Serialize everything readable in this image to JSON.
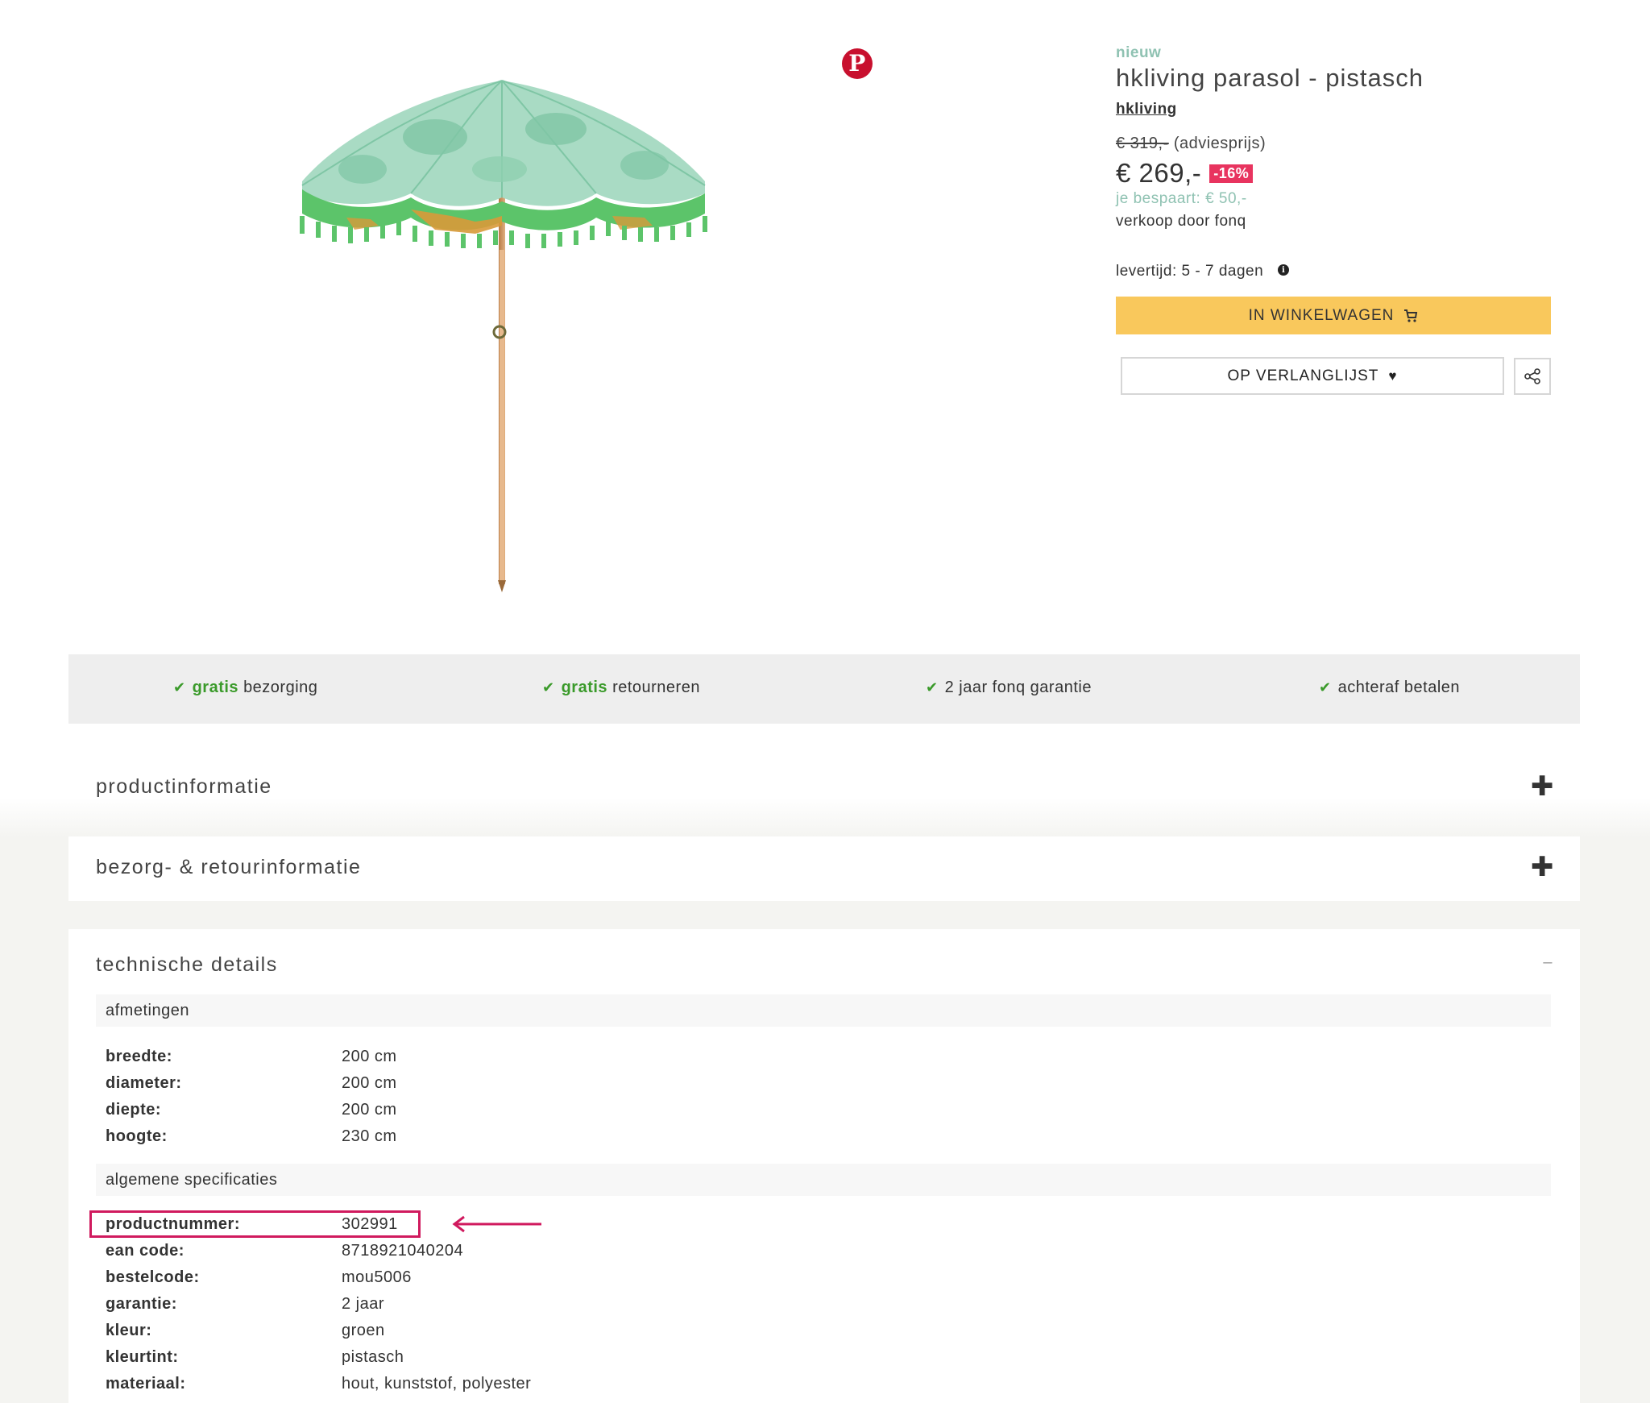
{
  "product": {
    "badge": "nieuw",
    "title": "hkliving parasol - pistasch",
    "brand": "hkliving",
    "old_price": "€ 319,-",
    "old_price_note": "(adviesprijs)",
    "price": "€ 269,-",
    "discount": "-16%",
    "savings": "je bespaart: € 50,-",
    "seller": "verkoop door fonq",
    "delivery": "levertijd: 5 - 7 dagen",
    "cart_label": "IN WINKELWAGEN",
    "wishlist_label": "OP VERLANGLIJST"
  },
  "usps": [
    {
      "highlight": "gratis",
      "text": "bezorging"
    },
    {
      "highlight": "gratis",
      "text": "retourneren"
    },
    {
      "highlight": "",
      "text": "2 jaar fonq garantie"
    },
    {
      "highlight": "",
      "text": "achteraf betalen"
    }
  ],
  "accordions": {
    "productinfo": "productinformatie",
    "shipping": "bezorg- & retourinformatie",
    "technical": "technische details"
  },
  "specs": {
    "dimensions_title": "afmetingen",
    "dimensions": [
      {
        "key": "breedte:",
        "value": "200 cm"
      },
      {
        "key": "diameter:",
        "value": "200 cm"
      },
      {
        "key": "diepte:",
        "value": "200 cm"
      },
      {
        "key": "hoogte:",
        "value": "230 cm"
      }
    ],
    "general_title": "algemene specificaties",
    "general": [
      {
        "key": "productnummer:",
        "value": "302991"
      },
      {
        "key": "ean code:",
        "value": "8718921040204"
      },
      {
        "key": "bestelcode:",
        "value": "mou5006"
      },
      {
        "key": "garantie:",
        "value": "2 jaar"
      },
      {
        "key": "kleur:",
        "value": "groen"
      },
      {
        "key": "kleurtint:",
        "value": "pistasch"
      },
      {
        "key": "materiaal:",
        "value": "hout, kunststof, polyester"
      }
    ]
  },
  "colors": {
    "accent_yellow": "#f9c85c",
    "discount_pink": "#e8345f",
    "check_green": "#3a9a2a",
    "annotation": "#d01a5e"
  }
}
